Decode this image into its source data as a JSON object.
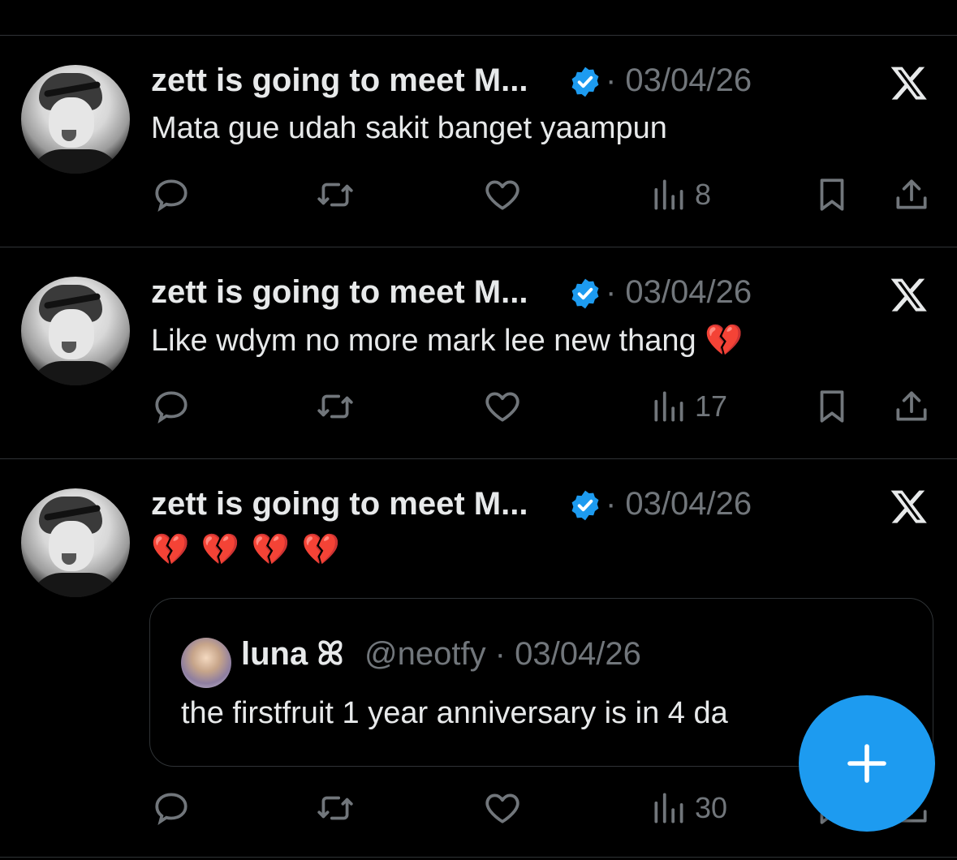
{
  "colors": {
    "accent": "#1d9bf0",
    "muted": "#71767b",
    "text": "#e7e9ea",
    "broken_heart": "#e0245e"
  },
  "tweets": [
    {
      "author": "zett is going to meet M...",
      "meta": "· 03/04/26",
      "text": "Mata gue udah sakit banget yaampun",
      "emoji_suffix": "",
      "stats": {
        "views": "8"
      }
    },
    {
      "author": "zett is going to meet M...",
      "meta": "· 03/04/26",
      "text": "Like wdym no more mark lee new thang",
      "emoji_suffix": "💔",
      "stats": {
        "views": "17"
      }
    },
    {
      "author": "zett is going to meet M...",
      "meta": "· 03/04/26",
      "text": "",
      "emoji_text": "💔 💔 💔 💔",
      "stats": {
        "views": "30"
      },
      "quote": {
        "name": "luna ꕤ",
        "handle": "@neotfy · 03/04/26",
        "text": "the firstfruit 1 year anniversary is in 4 da"
      }
    }
  ],
  "icons": [
    "reply-icon",
    "repost-icon",
    "like-icon",
    "views-icon",
    "bookmark-icon",
    "share-icon",
    "x-logo-icon",
    "verified-badge-icon",
    "compose-plus-icon"
  ]
}
